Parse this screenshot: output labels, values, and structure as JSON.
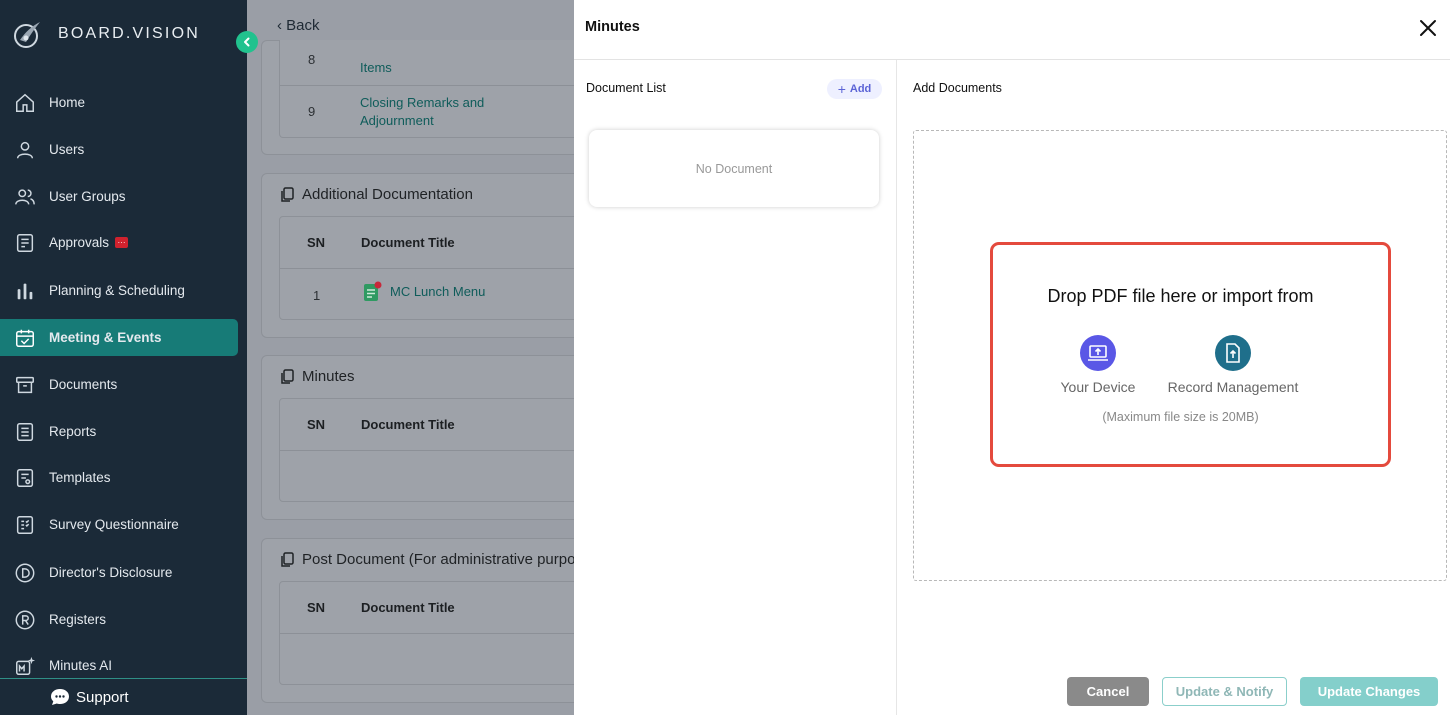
{
  "brand": {
    "name": "BOARD.VISION"
  },
  "sidebar": {
    "items": [
      {
        "label": "Home",
        "icon": "home-icon"
      },
      {
        "label": "Users",
        "icon": "user-icon"
      },
      {
        "label": "User Groups",
        "icon": "user-group-icon"
      },
      {
        "label": "Approvals",
        "icon": "approvals-icon",
        "badge": "···"
      },
      {
        "label": "Planning & Scheduling",
        "icon": "bar-chart-icon"
      },
      {
        "label": "Meeting & Events",
        "icon": "calendar-check-icon",
        "active": true
      },
      {
        "label": "Documents",
        "icon": "archive-icon"
      },
      {
        "label": "Reports",
        "icon": "report-icon"
      },
      {
        "label": "Templates",
        "icon": "template-icon"
      },
      {
        "label": "Survey Questionnaire",
        "icon": "survey-icon"
      },
      {
        "label": "Director's Disclosure",
        "icon": "circle-d-icon"
      },
      {
        "label": "Registers",
        "icon": "circle-r-icon"
      },
      {
        "label": "Minutes AI",
        "icon": "minutes-ai-icon"
      }
    ],
    "support_label": "Support"
  },
  "background": {
    "back_label": "Back",
    "agenda_rows": [
      {
        "sn": "8",
        "title": "Items"
      },
      {
        "sn": "9",
        "title": "Closing Remarks and Adjournment"
      }
    ],
    "sections": [
      {
        "title": "Additional Documentation",
        "col_sn": "SN",
        "col_title": "Document Title",
        "rows": [
          {
            "sn": "1",
            "title": "MC Lunch Menu"
          }
        ]
      },
      {
        "title": "Minutes",
        "col_sn": "SN",
        "col_title": "Document Title",
        "rows": []
      },
      {
        "title": "Post Document (For administrative purpos",
        "col_sn": "SN",
        "col_title": "Document Title",
        "rows": []
      }
    ]
  },
  "modal": {
    "title": "Minutes",
    "document_list_label": "Document List",
    "add_label": "Add",
    "no_document": "No Document",
    "add_documents_label": "Add Documents",
    "drop_text": "Drop PDF file here or import from",
    "sources": [
      {
        "label": "Your Device",
        "icon": "laptop-upload-icon",
        "color": "#5a57e6"
      },
      {
        "label": "Record Management",
        "icon": "file-upload-icon",
        "color": "#1f6f8b"
      }
    ],
    "max_size": "(Maximum file size is 20MB)",
    "buttons": {
      "cancel": "Cancel",
      "update_notify": "Update & Notify",
      "update_changes": "Update Changes"
    }
  },
  "colors": {
    "sidebar_bg": "#1b2a38",
    "active_bg": "#177b77",
    "accent_green": "#21c28e",
    "highlight_red": "#e44a3d"
  }
}
